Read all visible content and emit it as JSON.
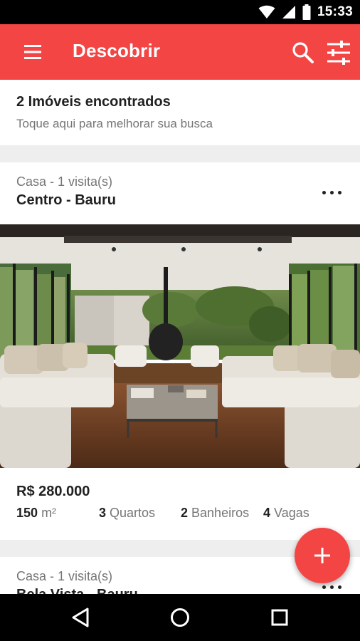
{
  "status_bar": {
    "time": "15:33",
    "icons": [
      "wifi-icon",
      "signal-icon",
      "battery-icon"
    ]
  },
  "app_bar": {
    "title": "Descobrir",
    "background_color": "#f44545",
    "icons": [
      "menu-icon",
      "search-icon",
      "filter-icon"
    ]
  },
  "summary": {
    "count_text": "2 Imóveis encontrados",
    "hint_text": "Toque aqui para melhorar sua busca"
  },
  "listings": [
    {
      "type_visits": "Casa - 1 visita(s)",
      "location": "Centro - Bauru",
      "price": "R$ 280.000",
      "area_value": "150",
      "area_unit": "m²",
      "bedrooms_count": "3",
      "bedrooms_label": "Quartos",
      "bathrooms_count": "2",
      "bathrooms_label": "Banheiros",
      "parking_count": "4",
      "parking_label": "Vagas"
    },
    {
      "type_visits": "Casa - 1 visita(s)",
      "location": "Bela Vista - Bauru"
    }
  ],
  "fab": {
    "icon": "plus-icon",
    "color": "#f44545"
  },
  "nav_bar": {
    "icons": [
      "back-icon",
      "home-icon",
      "recents-icon"
    ]
  }
}
